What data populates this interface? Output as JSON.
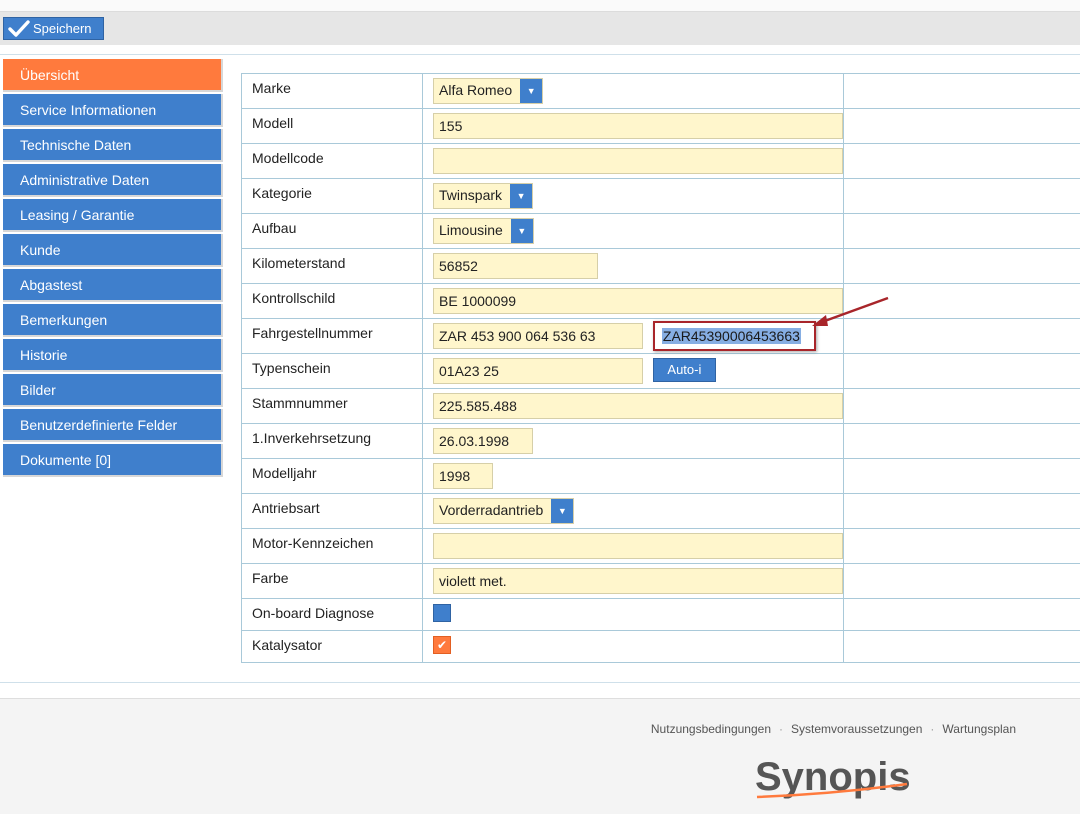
{
  "toolbar": {
    "save_label": "Speichern"
  },
  "nav": {
    "items": [
      {
        "label": "Übersicht",
        "active": true
      },
      {
        "label": "Service Informationen"
      },
      {
        "label": "Technische Daten"
      },
      {
        "label": "Administrative Daten"
      },
      {
        "label": "Leasing / Garantie"
      },
      {
        "label": "Kunde"
      },
      {
        "label": "Abgastest"
      },
      {
        "label": "Bemerkungen"
      },
      {
        "label": "Historie"
      },
      {
        "label": "Bilder"
      },
      {
        "label": "Benutzerdefinierte Felder"
      },
      {
        "label": "Dokumente [0]"
      }
    ]
  },
  "form": {
    "marke": {
      "label": "Marke",
      "value": "Alfa Romeo"
    },
    "modell": {
      "label": "Modell",
      "value": "155"
    },
    "modellcode": {
      "label": "Modellcode",
      "value": ""
    },
    "kategorie": {
      "label": "Kategorie",
      "value": "Twinspark"
    },
    "aufbau": {
      "label": "Aufbau",
      "value": "Limousine"
    },
    "kilometerstand": {
      "label": "Kilometerstand",
      "value": "56852"
    },
    "kontrollschild": {
      "label": "Kontrollschild",
      "value": "BE 1000099"
    },
    "fahrgestellnummer": {
      "label": "Fahrgestellnummer",
      "value": "ZAR 453 900 064 536 63",
      "compact": "ZAR45390006453663"
    },
    "typenschein": {
      "label": "Typenschein",
      "value": "01A23 25",
      "button": "Auto-i"
    },
    "stammnummer": {
      "label": "Stammnummer",
      "value": "225.585.488"
    },
    "inverkehrsetzung": {
      "label": "1.Inverkehrsetzung",
      "value": "26.03.1998"
    },
    "modelljahr": {
      "label": "Modelljahr",
      "value": "1998"
    },
    "antriebsart": {
      "label": "Antriebsart",
      "value": "Vorderradantrieb"
    },
    "motor_kennzeichen": {
      "label": "Motor-Kennzeichen",
      "value": ""
    },
    "farbe": {
      "label": "Farbe",
      "value": "violett met."
    },
    "onboard_diagnose": {
      "label": "On-board Diagnose",
      "checked": false
    },
    "katalysator": {
      "label": "Katalysator",
      "checked": true
    }
  },
  "footer": {
    "links": [
      "Nutzungsbedingungen",
      "Systemvoraussetzungen",
      "Wartungsplan"
    ],
    "logo_text": "Synopis"
  },
  "colors": {
    "accent": "#3f7fcc",
    "active": "#ff7a3d",
    "input_bg": "#fff6cc",
    "highlight_border": "#a8252a"
  }
}
